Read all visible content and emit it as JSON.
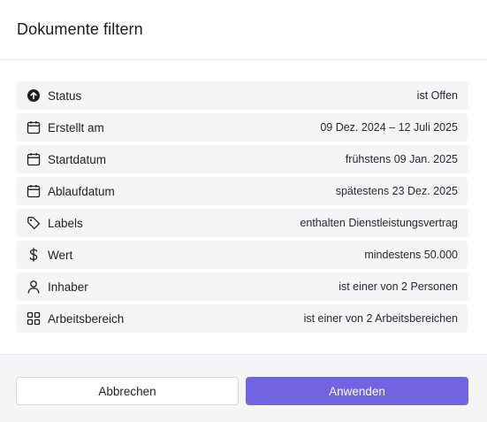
{
  "dialog": {
    "title": "Dokumente filtern"
  },
  "filters": [
    {
      "icon": "arrow-up-circle-icon",
      "label": "Status",
      "value": "ist Offen"
    },
    {
      "icon": "calendar-icon",
      "label": "Erstellt am",
      "value": "09 Dez. 2024 – 12 Juli 2025"
    },
    {
      "icon": "calendar-icon",
      "label": "Startdatum",
      "value": "frühstens 09 Jan. 2025"
    },
    {
      "icon": "calendar-icon",
      "label": "Ablaufdatum",
      "value": "spätestens 23 Dez. 2025"
    },
    {
      "icon": "tag-icon",
      "label": "Labels",
      "value": "enthalten Dienstleistungsvertrag"
    },
    {
      "icon": "dollar-icon",
      "label": "Wert",
      "value": "mindestens 50.000"
    },
    {
      "icon": "user-icon",
      "label": "Inhaber",
      "value": "ist einer von 2 Personen"
    },
    {
      "icon": "grid-icon",
      "label": "Arbeitsbereich",
      "value": "ist einer von 2 Arbeitsbereichen"
    }
  ],
  "footer": {
    "cancel_label": "Abbrechen",
    "apply_label": "Anwenden"
  },
  "colors": {
    "accent": "#7264e0",
    "row_background": "#f4f5f7",
    "footer_background": "#f5f5f7"
  }
}
